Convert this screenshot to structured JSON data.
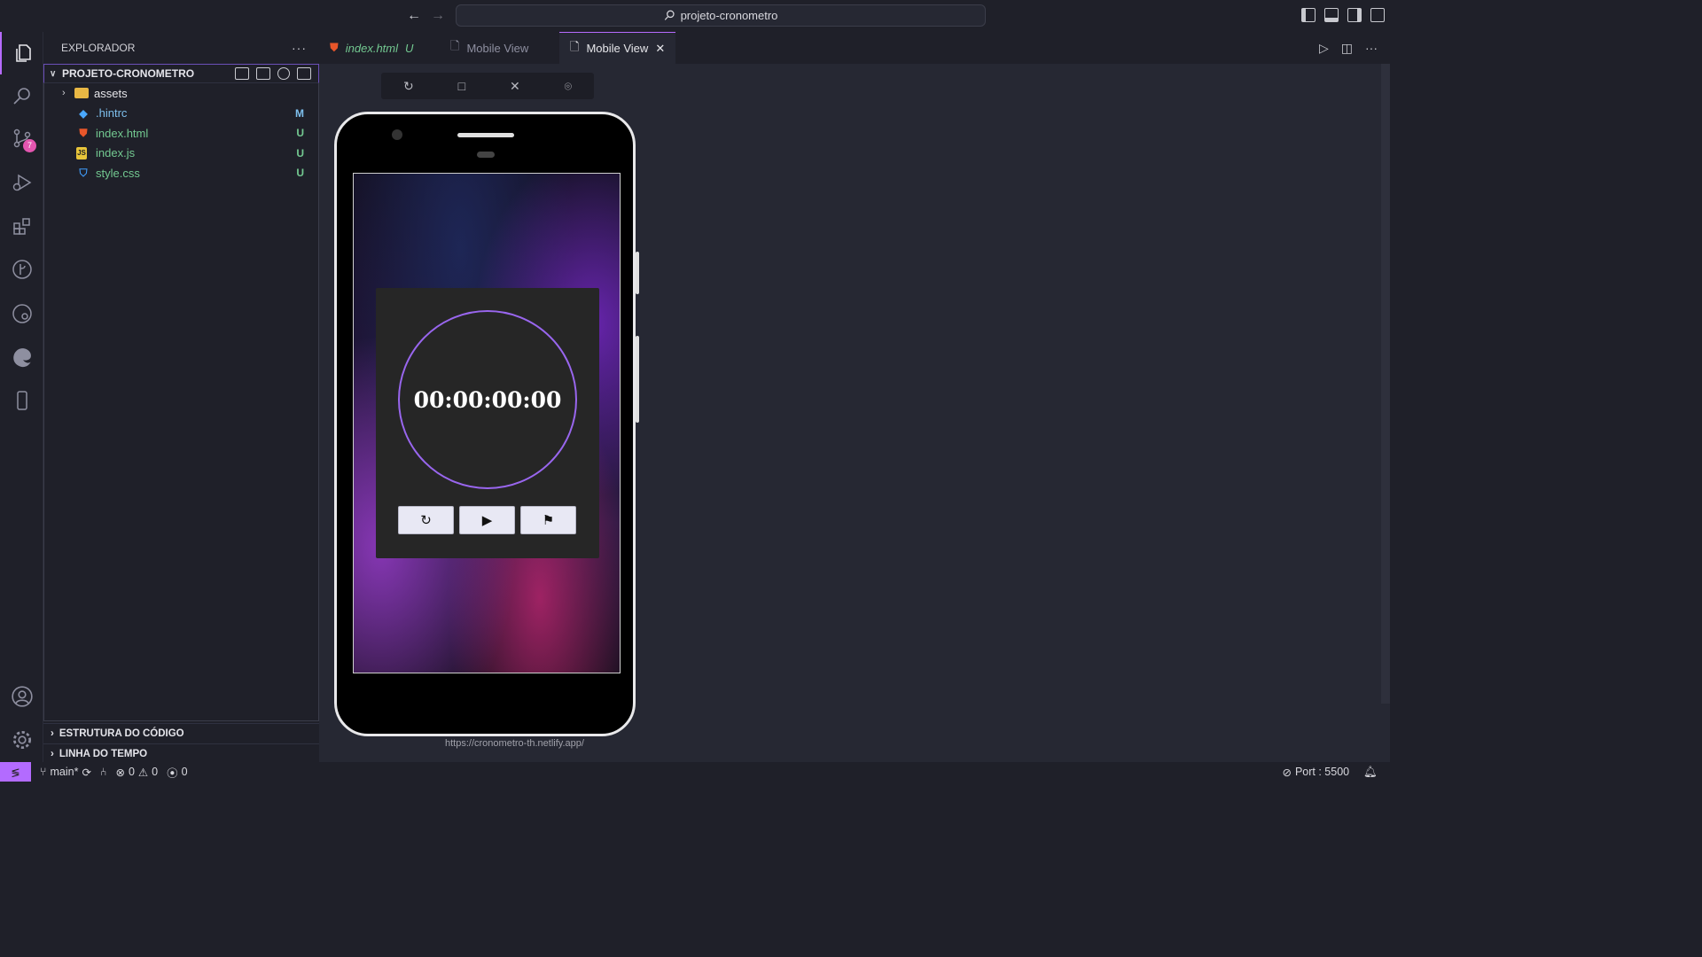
{
  "titlebar": {
    "search_text": "projeto-cronometro"
  },
  "activity_bar": {
    "source_control_badge": "7"
  },
  "explorer": {
    "title": "EXPLORADOR",
    "more": "···",
    "project_name": "PROJETO-CRONOMETRO",
    "files": [
      {
        "name": "assets",
        "type": "folder",
        "status": "",
        "color": "#e6e6ea"
      },
      {
        "name": ".hintrc",
        "type": "file",
        "status": "M",
        "color": "#7ec0ee",
        "status_color": "#7ec0ee"
      },
      {
        "name": "index.html",
        "type": "file",
        "status": "U",
        "color": "#73c991",
        "status_color": "#73c991"
      },
      {
        "name": "index.js",
        "type": "file",
        "status": "U",
        "color": "#73c991",
        "status_color": "#73c991"
      },
      {
        "name": "style.css",
        "type": "file",
        "status": "U",
        "color": "#73c991",
        "status_color": "#73c991"
      }
    ],
    "sections": [
      "ESTRUTURA DO CÓDIGO",
      "LINHA DO TEMPO"
    ]
  },
  "tabs": [
    {
      "label": "index.html",
      "suffix": "U"
    },
    {
      "label": "Mobile View"
    },
    {
      "label": "Mobile View",
      "close": "✕"
    }
  ],
  "preview": {
    "time": "00:00:00:00",
    "url": "https://cronometro-th.netlify.app/"
  },
  "statusbar": {
    "branch": "main*",
    "errors": "0",
    "warnings": "0",
    "ports": "0",
    "port_label": "Port : 5500"
  },
  "colors": {
    "accent": "#b66bff",
    "ring": "#9966ee"
  }
}
